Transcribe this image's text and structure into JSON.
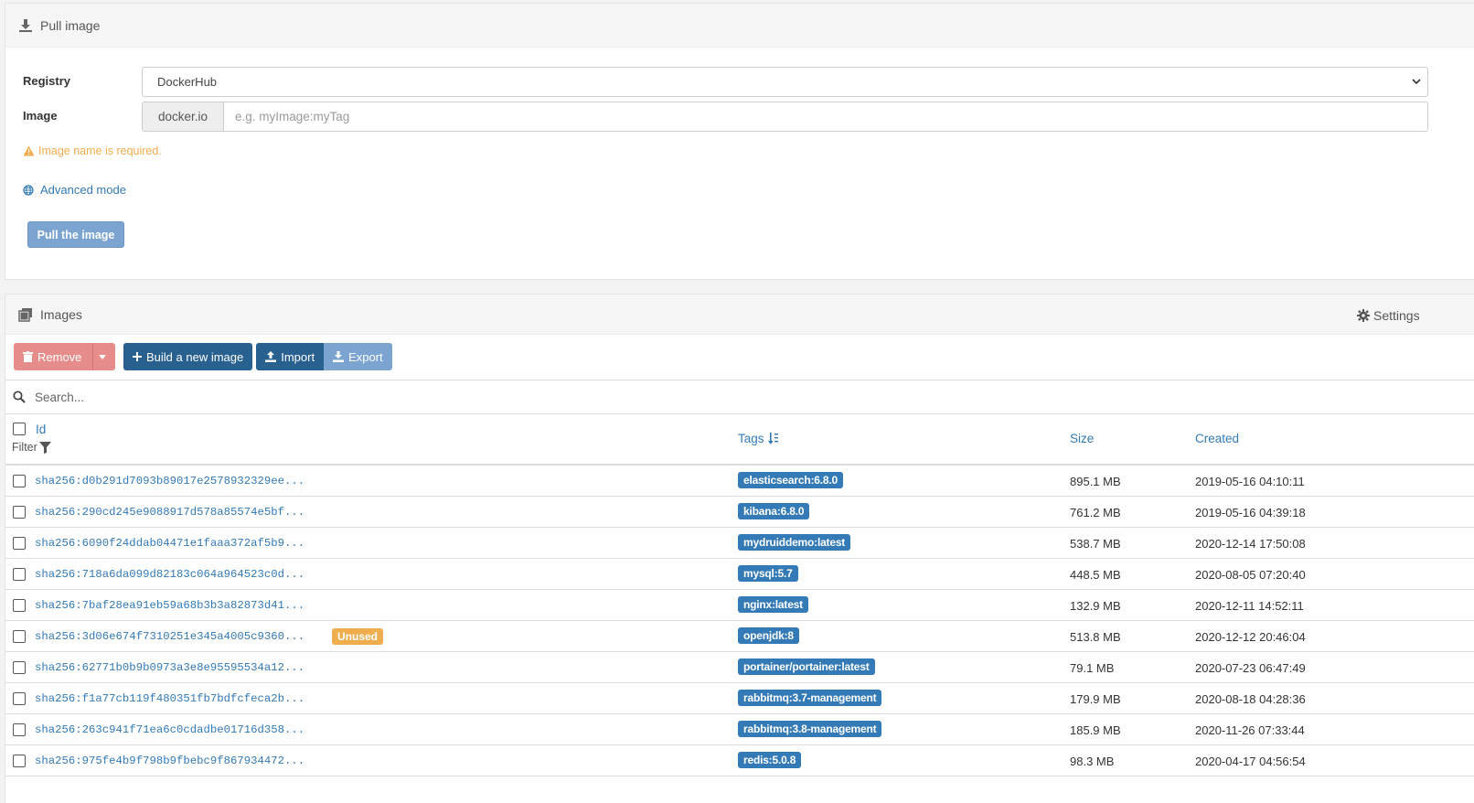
{
  "pull": {
    "title": "Pull image",
    "registry_label": "Registry",
    "registry_value": "DockerHub",
    "image_label": "Image",
    "image_prefix": "docker.io",
    "image_placeholder": "e.g. myImage:myTag",
    "image_value": "",
    "warning": "Image name is required.",
    "advanced_mode": "Advanced mode",
    "pull_button": "Pull the image"
  },
  "images": {
    "title": "Images",
    "settings": "Settings",
    "toolbar": {
      "remove": "Remove",
      "build": "Build a new image",
      "import": "Import",
      "export": "Export"
    },
    "search_placeholder": "Search...",
    "columns": {
      "id": "Id",
      "filter": "Filter",
      "tags": "Tags",
      "size": "Size",
      "created": "Created"
    },
    "rows": [
      {
        "id": "sha256:d0b291d7093b89017e2578932329ee...",
        "unused": "",
        "tag": "elasticsearch:6.8.0",
        "size": "895.1 MB",
        "created": "2019-05-16 04:10:11"
      },
      {
        "id": "sha256:290cd245e9088917d578a85574e5bf...",
        "unused": "",
        "tag": "kibana:6.8.0",
        "size": "761.2 MB",
        "created": "2019-05-16 04:39:18"
      },
      {
        "id": "sha256:6090f24ddab04471e1faaa372af5b9...",
        "unused": "",
        "tag": "mydruiddemo:latest",
        "size": "538.7 MB",
        "created": "2020-12-14 17:50:08"
      },
      {
        "id": "sha256:718a6da099d82183c064a964523c0d...",
        "unused": "",
        "tag": "mysql:5.7",
        "size": "448.5 MB",
        "created": "2020-08-05 07:20:40"
      },
      {
        "id": "sha256:7baf28ea91eb59a68b3b3a82873d41...",
        "unused": "",
        "tag": "nginx:latest",
        "size": "132.9 MB",
        "created": "2020-12-11 14:52:11"
      },
      {
        "id": "sha256:3d06e674f7310251e345a4005c9360...",
        "unused": "Unused",
        "tag": "openjdk:8",
        "size": "513.8 MB",
        "created": "2020-12-12 20:46:04"
      },
      {
        "id": "sha256:62771b0b9b0973a3e8e95595534a12...",
        "unused": "",
        "tag": "portainer/portainer:latest",
        "size": "79.1 MB",
        "created": "2020-07-23 06:47:49"
      },
      {
        "id": "sha256:f1a77cb119f480351fb7bdfcfeca2b...",
        "unused": "",
        "tag": "rabbitmq:3.7-management",
        "size": "179.9 MB",
        "created": "2020-08-18 04:28:36"
      },
      {
        "id": "sha256:263c941f71ea6c0cdadbe01716d358...",
        "unused": "",
        "tag": "rabbitmq:3.8-management",
        "size": "185.9 MB",
        "created": "2020-11-26 07:33:44"
      },
      {
        "id": "sha256:975fe4b9f798b9fbebc9f867934472...",
        "unused": "",
        "tag": "redis:5.0.8",
        "size": "98.3 MB",
        "created": "2020-04-17 04:56:54"
      }
    ]
  },
  "colors": {
    "primary": "#286090",
    "link": "#337ab7",
    "danger_disabled": "#e68d8b",
    "warning": "#f0ad4e"
  }
}
